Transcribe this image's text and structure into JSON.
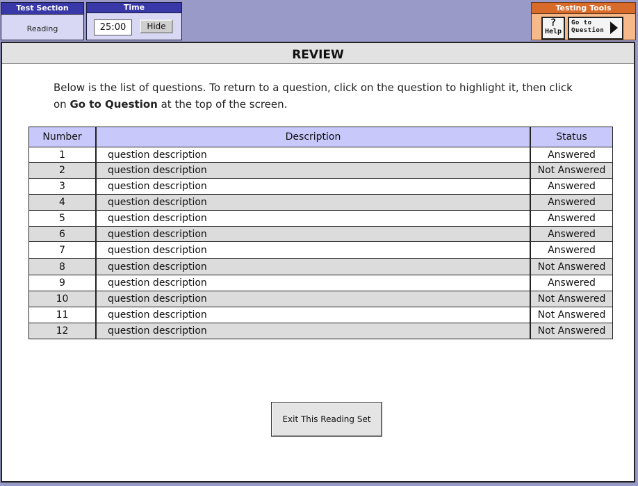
{
  "header": {
    "test_section_label": "Test Section",
    "test_section_value": "Reading",
    "time_label": "Time",
    "time_value": "25:00",
    "hide_label": "Hide",
    "tools_label": "Testing Tools",
    "help_symbol": "?",
    "help_label": "Help",
    "goto_line1": "Go to",
    "goto_line2": "Question"
  },
  "review": {
    "title": "REVIEW",
    "instruction_part1": "Below is the list of questions.  To return to a question, click on the question to highlight it, then click on ",
    "instruction_bold": "Go to Question",
    "instruction_part2": " at the top of the screen.",
    "columns": {
      "number": "Number",
      "description": "Description",
      "status": "Status"
    },
    "rows": [
      {
        "number": "1",
        "description": "question description",
        "status": "Answered"
      },
      {
        "number": "2",
        "description": "question description",
        "status": "Not Answered"
      },
      {
        "number": "3",
        "description": "question description",
        "status": "Answered"
      },
      {
        "number": "4",
        "description": "question description",
        "status": "Answered"
      },
      {
        "number": "5",
        "description": "question description",
        "status": "Answered"
      },
      {
        "number": "6",
        "description": "question description",
        "status": "Answered"
      },
      {
        "number": "7",
        "description": "question description",
        "status": "Answered"
      },
      {
        "number": "8",
        "description": "question description",
        "status": "Not Answered"
      },
      {
        "number": "9",
        "description": "question description",
        "status": "Answered"
      },
      {
        "number": "10",
        "description": "question description",
        "status": "Not Answered"
      },
      {
        "number": "11",
        "description": "question description",
        "status": "Not Answered"
      },
      {
        "number": "12",
        "description": "question description",
        "status": "Not Answered"
      }
    ],
    "exit_label": "Exit This Reading Set"
  },
  "colors": {
    "background": "#9a9ac8",
    "header_blue": "#3838a8",
    "table_header": "#c8c8fa",
    "row_shade": "#dcdcdc",
    "tools_orange": "#d86a2a"
  },
  "icons": {
    "help": "question-mark-icon",
    "goto": "play-arrow-icon"
  }
}
